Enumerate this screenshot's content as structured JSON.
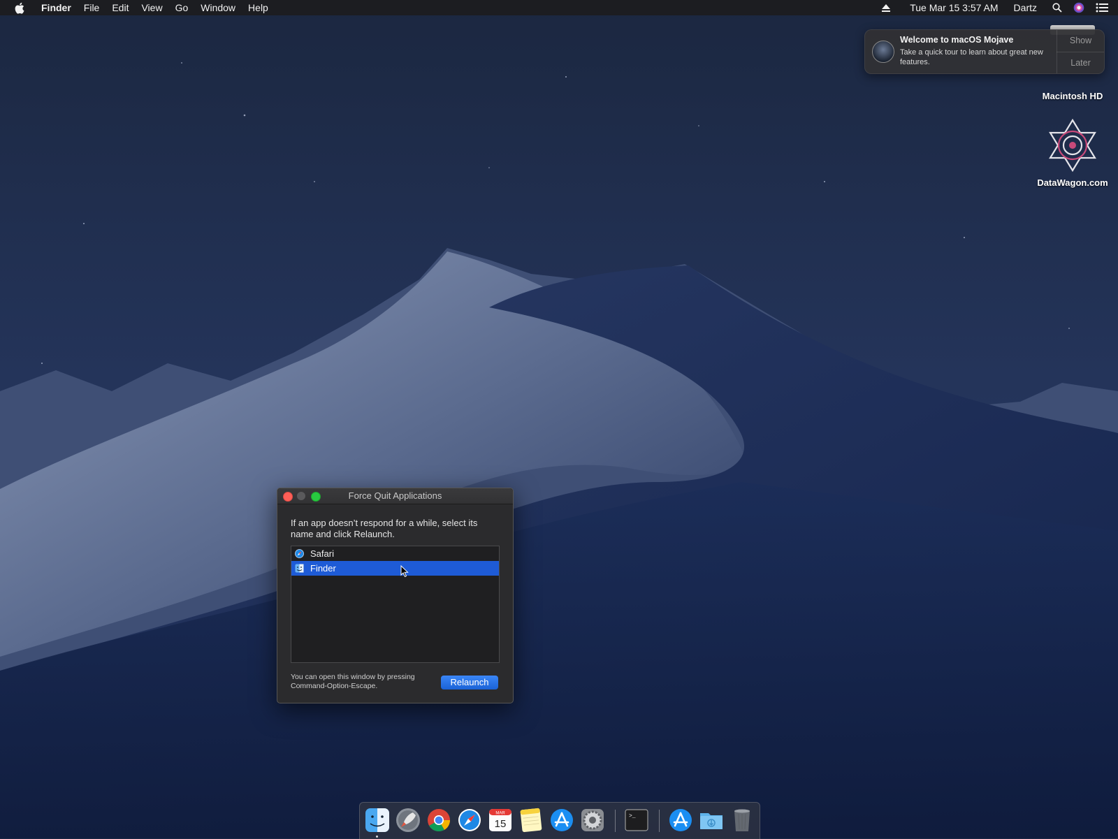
{
  "menubar": {
    "app_name": "Finder",
    "menus": [
      "File",
      "Edit",
      "View",
      "Go",
      "Window",
      "Help"
    ],
    "datetime": "Tue Mar 15  3:57 AM",
    "user": "Dartz"
  },
  "notification": {
    "title": "Welcome to macOS Mojave",
    "body": "Take a quick tour to learn about great new features.",
    "show_label": "Show",
    "later_label": "Later"
  },
  "desktop": {
    "hd_label": "Macintosh HD",
    "datawagon_label": "DataWagon.com"
  },
  "force_quit": {
    "title": "Force Quit Applications",
    "description": "If an app doesn’t respond for a while, select its name and click Relaunch.",
    "apps": [
      {
        "label": "Safari",
        "icon": "safari-icon",
        "selected": false
      },
      {
        "label": "Finder",
        "icon": "finder-icon",
        "selected": true
      }
    ],
    "hint": "You can open this window by pressing Command-Option-Escape.",
    "relaunch_label": "Relaunch"
  },
  "dock": {
    "calendar_month": "MAR",
    "calendar_day": "15",
    "terminal_prompt": ">_",
    "items": [
      "finder-icon",
      "launchpad-icon",
      "chrome-icon",
      "safari-icon",
      "calendar-icon",
      "notes-icon",
      "app-store-icon",
      "system-preferences-icon",
      "terminal-icon",
      "app-store-icon",
      "downloads-folder-icon",
      "trash-icon"
    ]
  },
  "colors": {
    "selection": "#1e5bd6",
    "menubar": "#1c1c1e",
    "window_bg": "#2b2b2d",
    "button_accent": "#1a62d6"
  }
}
